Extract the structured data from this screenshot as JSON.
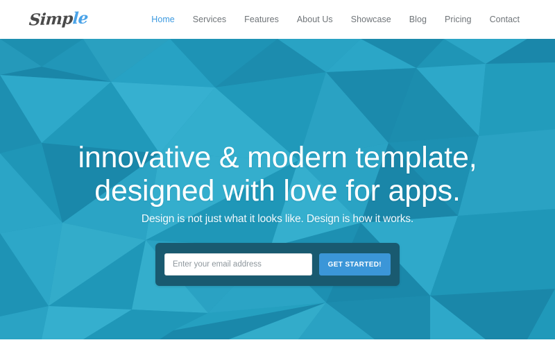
{
  "header": {
    "brand": {
      "text_dark": "Simp",
      "text_accent": "le",
      "full": "Simple"
    },
    "nav": [
      {
        "label": "Home",
        "active": true
      },
      {
        "label": "Services",
        "active": false
      },
      {
        "label": "Features",
        "active": false
      },
      {
        "label": "About Us",
        "active": false
      },
      {
        "label": "Showcase",
        "active": false
      },
      {
        "label": "Blog",
        "active": false
      },
      {
        "label": "Pricing",
        "active": false
      },
      {
        "label": "Contact",
        "active": false
      }
    ]
  },
  "hero": {
    "title_line1": "innovative & modern template,",
    "title_line2": "designed with love for apps.",
    "subtitle": "Design is not just what it looks like. Design is how it works.",
    "signup": {
      "email_placeholder": "Enter your email address",
      "email_value": "",
      "button_label": "GET STARTED!"
    }
  },
  "colors": {
    "header_bg": "#ffffff",
    "nav_text": "#6f7478",
    "nav_active": "#3d9ae0",
    "brand_dark": "#4a4a4a",
    "brand_accent": "#4aa3e8",
    "hero_base": "#2196b8",
    "hero_poly_light": "#35a8c6",
    "hero_poly_mid": "#1e92b4",
    "hero_poly_dark": "#14789a",
    "form_shell": "#195a70",
    "button_bg": "#3b96d8",
    "title_text": "#ffffff",
    "page_bg": "#ffffff"
  }
}
